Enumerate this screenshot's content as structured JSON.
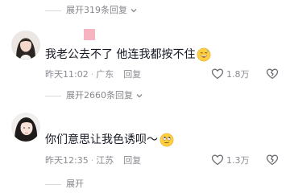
{
  "top_expand": {
    "label": "展开319条回复"
  },
  "comments": [
    {
      "text": "我老公去不了 他连我都按不住",
      "time": "昨天11:02",
      "location": "广东",
      "reply_label": "回复",
      "likes": "1.8万",
      "emoji": "grinning-sweat-emoji"
    },
    {
      "text": "你们意思让我色诱呗～",
      "time": "昨天12:35",
      "location": "江苏",
      "reply_label": "回复",
      "likes": "1.3万",
      "emoji": "rolling-eyes-emoji"
    }
  ],
  "mid_expand": {
    "label": "展开2660条回复"
  },
  "bottom_expand": {
    "label": "展开"
  },
  "colors": {
    "meta": "#8a8b91",
    "text": "#161823",
    "divider": "#d9d9dc"
  }
}
